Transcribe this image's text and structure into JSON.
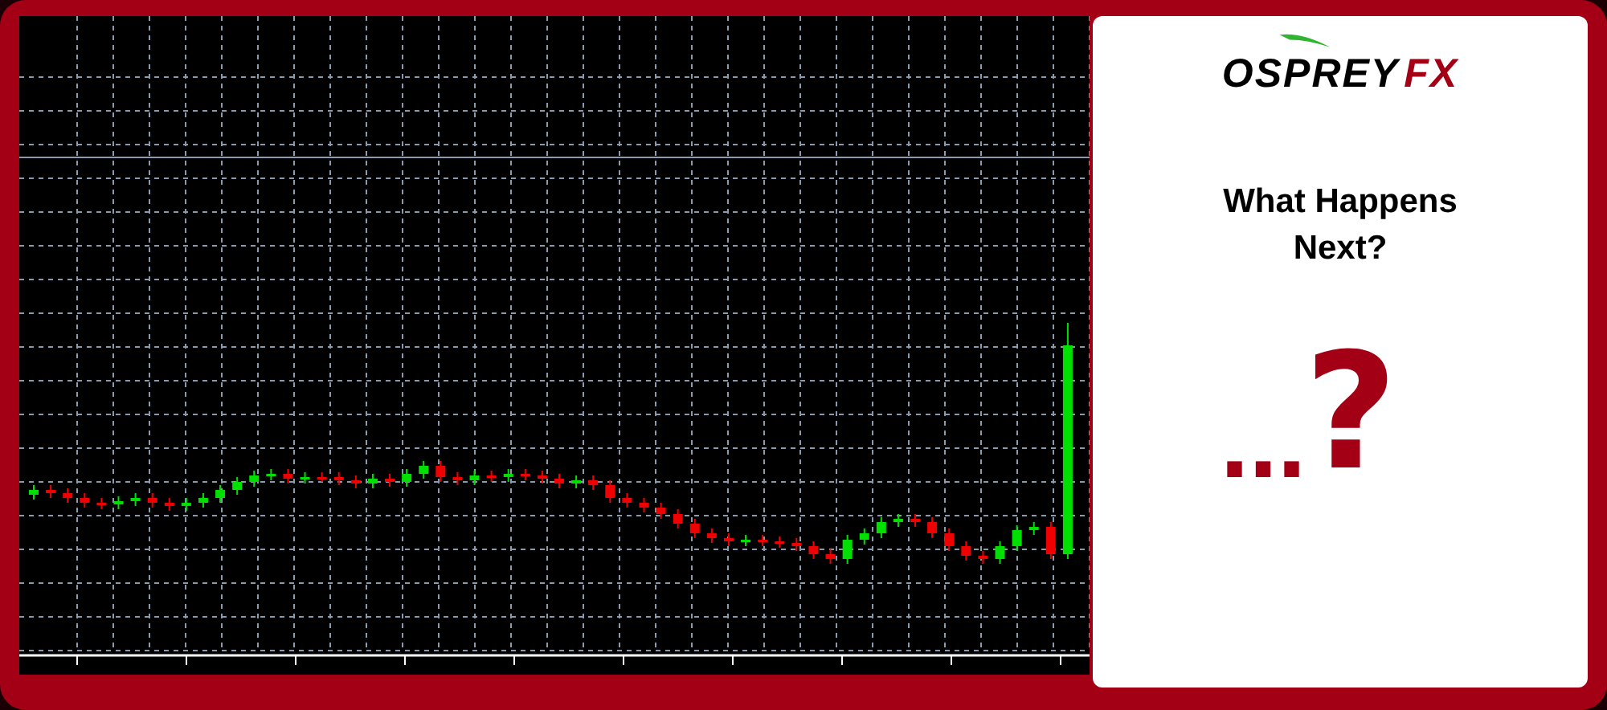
{
  "logo": {
    "name": "OSPREY",
    "accent": "FX"
  },
  "headline": "What Happens Next?",
  "teaser": {
    "dots": "...",
    "mark": "?"
  }
}
